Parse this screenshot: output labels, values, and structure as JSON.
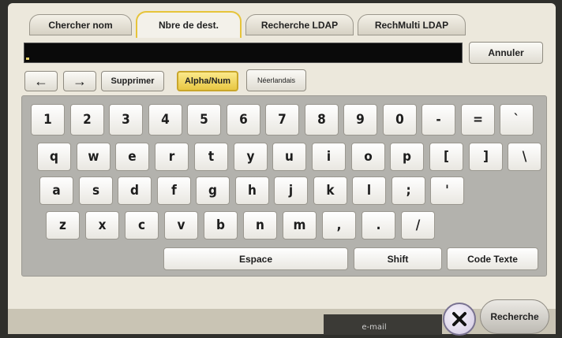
{
  "tabs": [
    {
      "label": "Chercher nom"
    },
    {
      "label": "Nbre de dest."
    },
    {
      "label": "Recherche LDAP"
    },
    {
      "label": "RechMulti LDAP"
    }
  ],
  "toolbar": {
    "cancel_label": "Annuler",
    "back_arrow": "←",
    "forward_arrow": "→",
    "delete_label": "Supprimer",
    "alpha_num_label": "Alpha/Num",
    "lang_label": "Néerlandais"
  },
  "keyboard": {
    "row1": [
      "1",
      "2",
      "3",
      "4",
      "5",
      "6",
      "7",
      "8",
      "9",
      "0",
      "-",
      "=",
      "`"
    ],
    "row2": [
      "q",
      "w",
      "e",
      "r",
      "t",
      "y",
      "u",
      "i",
      "o",
      "p",
      "[",
      "]",
      "\\"
    ],
    "row3": [
      "a",
      "s",
      "d",
      "f",
      "g",
      "h",
      "j",
      "k",
      "l",
      ";",
      "'"
    ],
    "row4": [
      "z",
      "x",
      "c",
      "v",
      "b",
      "n",
      "m",
      ",",
      ".",
      "/"
    ],
    "space_label": "Espace",
    "shift_label": "Shift",
    "code_label": "Code Texte"
  },
  "footer": {
    "email_label": "e-mail",
    "search_label": "Recherche"
  },
  "colors": {
    "active_accent": "#e6c43a",
    "background": "#ece8dc"
  }
}
